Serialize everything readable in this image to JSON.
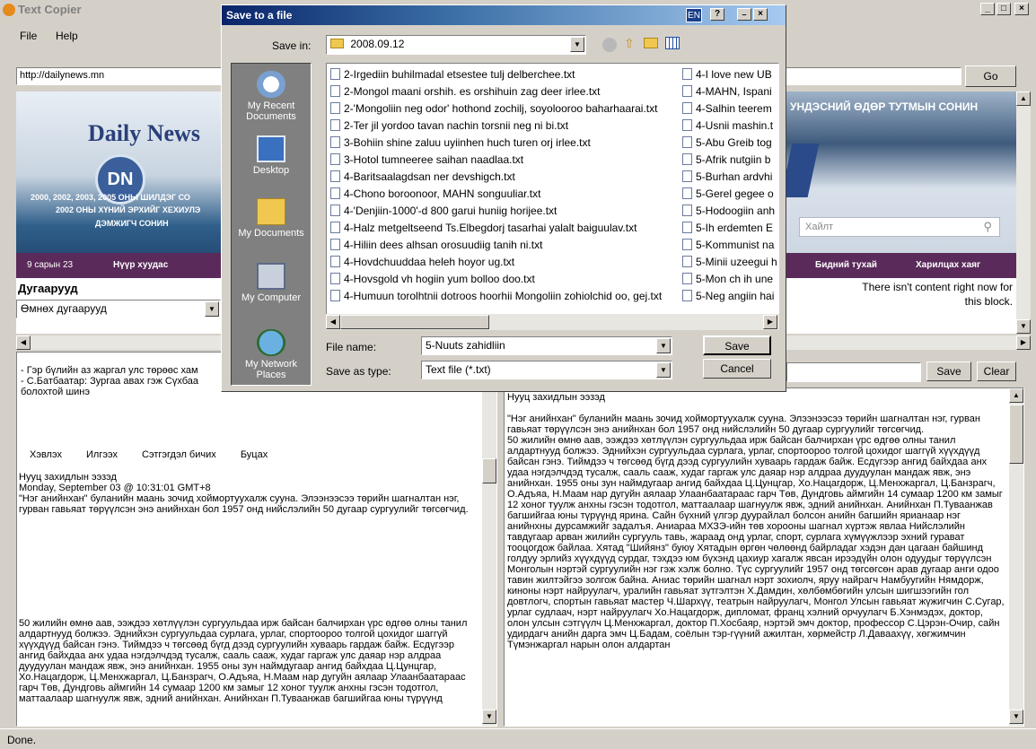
{
  "app": {
    "title": "Text Copier",
    "menu": [
      "File",
      "Help"
    ],
    "status": "Done."
  },
  "window_buttons": [
    "_",
    "□",
    "×"
  ],
  "browser": {
    "url": "http://dailynews.mn",
    "go_label": "Go",
    "logo": "Daily News",
    "logo_badge": "DN",
    "banner_text_1": "2000, 2002, 2003, 2005 ОНЫ ШИЛДЭГ СО",
    "banner_text_2": "2002 ОНЫ ХҮНИЙ ЭРХИЙГ ХЕХИУЛЭ",
    "banner_text_3": "ДЭМЖИГЧ СОНИН",
    "date": "9 сарын 23",
    "nav_left": "Нүүр хуудас",
    "right_headline": "УНДЭСНИЙ ӨДӨР ТУТМЫН СОНИН",
    "search_placeholder": "Хайлт",
    "nav_right_1": "Бидний тухай",
    "nav_right_2": "Харилцах хаяг",
    "archive_label": "Дугаарууд",
    "archive_select": "Өмнөх дугаарууд",
    "no_content": "There isn't content right now for this block."
  },
  "left_pane": {
    "top_lines": [
      "- Гэр бүлийн аз жаргал улс төрөөс хам",
      "- С.Батбаатар: Зургаа авах гэж Сүхбаа",
      "болохтой шинэ"
    ],
    "links": [
      "Хэвлэх",
      "Илгээх",
      "Сэтгэгдэл бичих",
      "Буцах"
    ],
    "heading": "Нууц захидлын ээзэд",
    "dateline": "Monday, September 03 @ 10:31:01 GMT+8",
    "para1": "\"Нэг анийнхан\" буланийн маань зочид хоймортуухалж сууна. Элээнээсээ төрийн шагналтан нэг, гурван гавьяат төрүүлсэн энэ анийнхан бол 1957 онд нийслэлийн 50 дугаар сургуулийг төгсөгчид.",
    "para2": "50 жилийн өмнө аав, ээждээ хөтлүүлэн сургуульдаа ирж байсан балчирхан үрс өдгөө олны танил алдартнууд болжээ. Эднийхэн сургуульдаа сурлага, урлаг, спортоороо толгой цохидог шаггүй хүүхдүүд байсан гэнэ. Тиймдээ ч төгсөөд бүгд дээд сургуулийн хуваарь гардаж байж. Есдүгээр ангид байхдаа анх удаа нэгдэлчдэд тусалж, сааль сааж, худаг гаргаж улс даяар нэр алдраа дуудуулан мандаж явж, энэ анийнхан. 1955 оны зун наймдугаар ангид байхдаа Ц.Цунцгар, Хо.Нацагдорж, Ц.Менхжаргал, Ц.Банзрагч, О.Адъяа, Н.Маам нар дугуйн аялаар Улаанбаатараас гарч Төв, Дундговь аймгийн 14 сумаар 1200 км замыг 12 хоног туулж анхны гэсэн тодотгол, маттаалаар шагнуулж явж, эдний анийнхан. Анийнхан П.Туваанжав багшийгаа юны түрүүнд"
  },
  "right_pane": {
    "save_label": "Save",
    "clear_label": "Clear",
    "heading": "Нууц захидлын ээзэд",
    "para1": "\"Нэг анийнхан\" буланийн маань зочид хоймортуухалж сууна. Элээнээсээ төрийн шагналтан нэг, гурван гавьяат төрүүлсэн энэ анийнхан бол 1957 онд нийслэлийн 50 дугаар сургуулийг төгсөгчид.",
    "para2": "50 жилийн өмнө аав, ээждээ хөтлүүлэн сургуульдаа ирж байсан балчирхан үрс өдгөө олны танил алдартнууд болжээ. Эднийхэн сургуульдаа сурлага, урлаг, спортоороо толгой цохидог шаггүй хүүхдүүд байсан гэнэ. Тиймдээ ч төгсөөд бүгд дээд сургуулийн хуваарь гардаж байж. Есдүгээр ангид байхдаа анх удаа нэгдэлчдэд тусалж, сааль сааж, худаг гаргаж улс даяар нэр алдраа дуудуулан мандаж явж, энэ анийнхан. 1955 оны зун наймдугаар ангид байхдаа Ц.Цунцгар, Хо.Нацагдорж, Ц.Менхжаргал, Ц.Банзрагч, О.Адъяа, Н.Маам нар дугуйн аялаар Улаанбаатараас гарч Төв, Дундговь аймгийн 14 сумаар 1200 км замыг 12 хоног туулж анхны гэсэн тодотгол, маттаалаар шагнуулж явж, эдний анийнхан. Анийнхан П.Туваанжав багшийгаа юны түрүүнд ярина. Сайн бүхний үлгэр дуурайлал болсон анийн багшийн ярианаар нэг анийнхны дурсамжийг задалъя. Аниараа МХЗЭ-ийн төв хорооны шагнал хүртэж явлаа Нийслэлийн тавдугаар арван жилийн сургууль тавь, жараад онд урлаг, спорт, сурлага хүмүүжлээр эхний гурават тооцогдож байлаа. Хятад \"Шийянз\" буюу Хятадын өргөн чөлөөнд байрладаг хэдэн дан цагаан байшинд голдуу эрлийз хүүхдүүд сурдаг, тэхдээ юм бүхэнд цахиур хагалж явсан ирээдүйн олон одуудыг төрүүлсэн Монголын нэртэй сургуулийн нэг гэж хэлж болно. Түс сургуулийг 1957 онд төгсөгсөн арав дугаар анги одоо тавин жилтэйгээ золгож байна. Аниас төрийн шагнал нэрт зохиолч, яруу найрагч Намбуугийн Нямдорж, киноны нэрт найруулагч, уралийн гавьяат зүтгэлтэн Х.Дамдин, хөлбөмбөгийн улсын шигшээгийн гол довтлогч, спортын гавьяат мастер Ч.Шархүү, театрын найруулагч, Монгол Улсын гавьяат жүжигчин С.Сугар, урлаг судлаач, нэрт найруулагч Хо.Нацагдорж, дипломат, франц хэлний орчуулагч Б.Хэнмэдэх, доктор, олон улсын сэтгүүлч Ц.Менхжаргал, доктор П.Хосбаяр, нэртэй эмч доктор, профессор С.Цэрэн-Очир, сайн удирдагч анийн дарга эмч Ц.Бадам, соёлын тэр-гүүний ажилтан, хөрмейстр Л.Даваахүү, хөгжимчин Түмэнжаргал нарын олон алдартан"
  },
  "dialog": {
    "title": "Save to a file",
    "lang": "EN",
    "help": "?",
    "save_in_label": "Save in:",
    "folder": "2008.09.12",
    "places": [
      "My Recent Documents",
      "Desktop",
      "My Documents",
      "My Computer",
      "My Network Places"
    ],
    "files_col1": [
      "2-Irgediin buhilmadal etsestee tulj delberchee.txt",
      "2-Mongol maani orshih. es orshihuin zag deer irlee.txt",
      "2-'Mongoliin neg odor' hothond zochilj, soyolooroo baharhaarai.txt",
      "2-Ter jil yordoo tavan nachin torsnii neg ni bi.txt",
      "3-Bohiin shine zaluu uyiinhen huch turen orj irlee.txt",
      "3-Hotol tumneeree saihan naadlaa.txt",
      "4-Baritsaalagdsan ner devshigch.txt",
      "4-Chono boroonoor, MAHN songuuliar.txt",
      "4-'Denjiin-1000'-d 800 garui huniig horijee.txt",
      "4-Halz metgeltseend Ts.Elbegdorj tasarhai yalalt baiguulav.txt",
      "4-Hiliin dees alhsan orosuudiig tanih ni.txt",
      "4-Hovdchuuddaa heleh hoyor ug.txt",
      "4-Hovsgold vh hogiin yum bolloo doo.txt",
      "4-Humuun torolhtnii dotroos hoorhii Mongoliin zohiolchid oo, gej.txt"
    ],
    "files_col2": [
      "4-I love new UB",
      "4-MAHN, Ispani",
      "4-Salhin teerem",
      "4-Usnii mashin.t",
      "5-Abu Greib tog",
      "5-Afrik nutgiin b",
      "5-Burhan ardvhi",
      "5-Gerel gegee o",
      "5-Hodoogiin anh",
      "5-Ih erdemten E",
      "5-Kommunist na",
      "5-Minii uzeegui h",
      "5-Mon ch ih une",
      "5-Neg angiin hai"
    ],
    "file_name_label": "File name:",
    "file_name": "5-Nuuts zahidliin",
    "save_type_label": "Save as type:",
    "save_type": "Text file (*.txt)",
    "save_btn": "Save",
    "cancel_btn": "Cancel"
  }
}
